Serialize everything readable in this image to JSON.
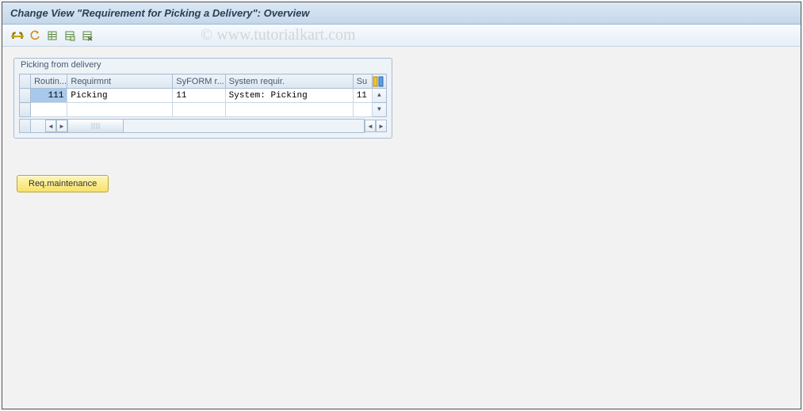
{
  "title": "Change View \"Requirement for Picking a Delivery\": Overview",
  "watermark": "© www.tutorialkart.com",
  "toolbar_icons": {
    "change": "change-icon",
    "undo": "undo-icon",
    "save1": "table-icon",
    "save2": "table-save-icon",
    "save3": "table-del-icon"
  },
  "group_label": "Picking from delivery",
  "columns": {
    "routine": "Routin...",
    "requirement": "Requirmnt",
    "syform": "SyFORM r...",
    "system_req": "System requir.",
    "su": "Su"
  },
  "rows": [
    {
      "routine": "111",
      "requirement": "Picking",
      "syform": "11",
      "system_req": "System: Picking",
      "su": "11"
    },
    {
      "routine": "",
      "requirement": "",
      "syform": "",
      "system_req": "",
      "su": ""
    }
  ],
  "button_req_maintenance": "Req.maintenance"
}
